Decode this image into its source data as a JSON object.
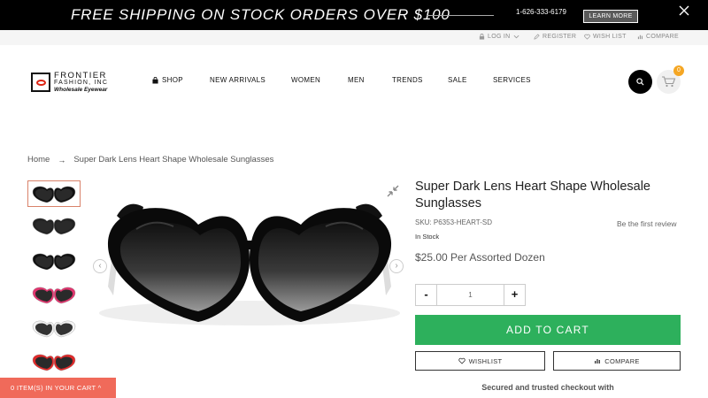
{
  "promo": {
    "text": "FREE SHIPPING ON STOCK ORDERS OVER $100",
    "phone": "1-626-333-6179",
    "learn_more": "LEARN MORE"
  },
  "util": {
    "login": "LOG IN",
    "register": "REGISTER",
    "wishlist": "WISH LIST",
    "compare": "COMPARE"
  },
  "logo": {
    "line1": "FRONTIER",
    "line2": "FASHION, INC",
    "line3": "Wholesale Eyewear"
  },
  "nav": {
    "shop": "SHOP",
    "new_arrivals": "NEW ARRIVALS",
    "women": "WOMEN",
    "men": "MEN",
    "trends": "TRENDS",
    "sale": "SALE",
    "services": "SERVICES"
  },
  "cart_count": "0",
  "breadcrumb": {
    "home": "Home",
    "separator": "→",
    "current": "Super Dark Lens Heart Shape Wholesale Sunglasses"
  },
  "thumbnails": [
    {
      "frame_color": "#111111"
    },
    {
      "frame_color": "#222222"
    },
    {
      "frame_color": "#111111"
    },
    {
      "frame_color": "#e0356e"
    },
    {
      "frame_color": "#f2f2f2"
    },
    {
      "frame_color": "#e02a2a"
    }
  ],
  "product": {
    "title": "Super Dark Lens Heart Shape Wholesale Sunglasses",
    "sku": "SKU: P6353-HEART-SD",
    "review_link": "Be the first review",
    "stock": "In Stock",
    "price": "$25.00 Per Assorted Dozen",
    "qty_minus": "-",
    "qty_value": "1",
    "qty_plus": "+",
    "add_to_cart": "ADD TO CART",
    "wishlist": "WISHLIST",
    "compare": "COMPARE",
    "secure_text": "Secured and trusted checkout with"
  },
  "cart_float": "0 ITEM(S) IN YOUR CART ^",
  "colors": {
    "accent_green": "#2db05c",
    "cart_float": "#f06a5a",
    "badge": "#f5a623"
  }
}
